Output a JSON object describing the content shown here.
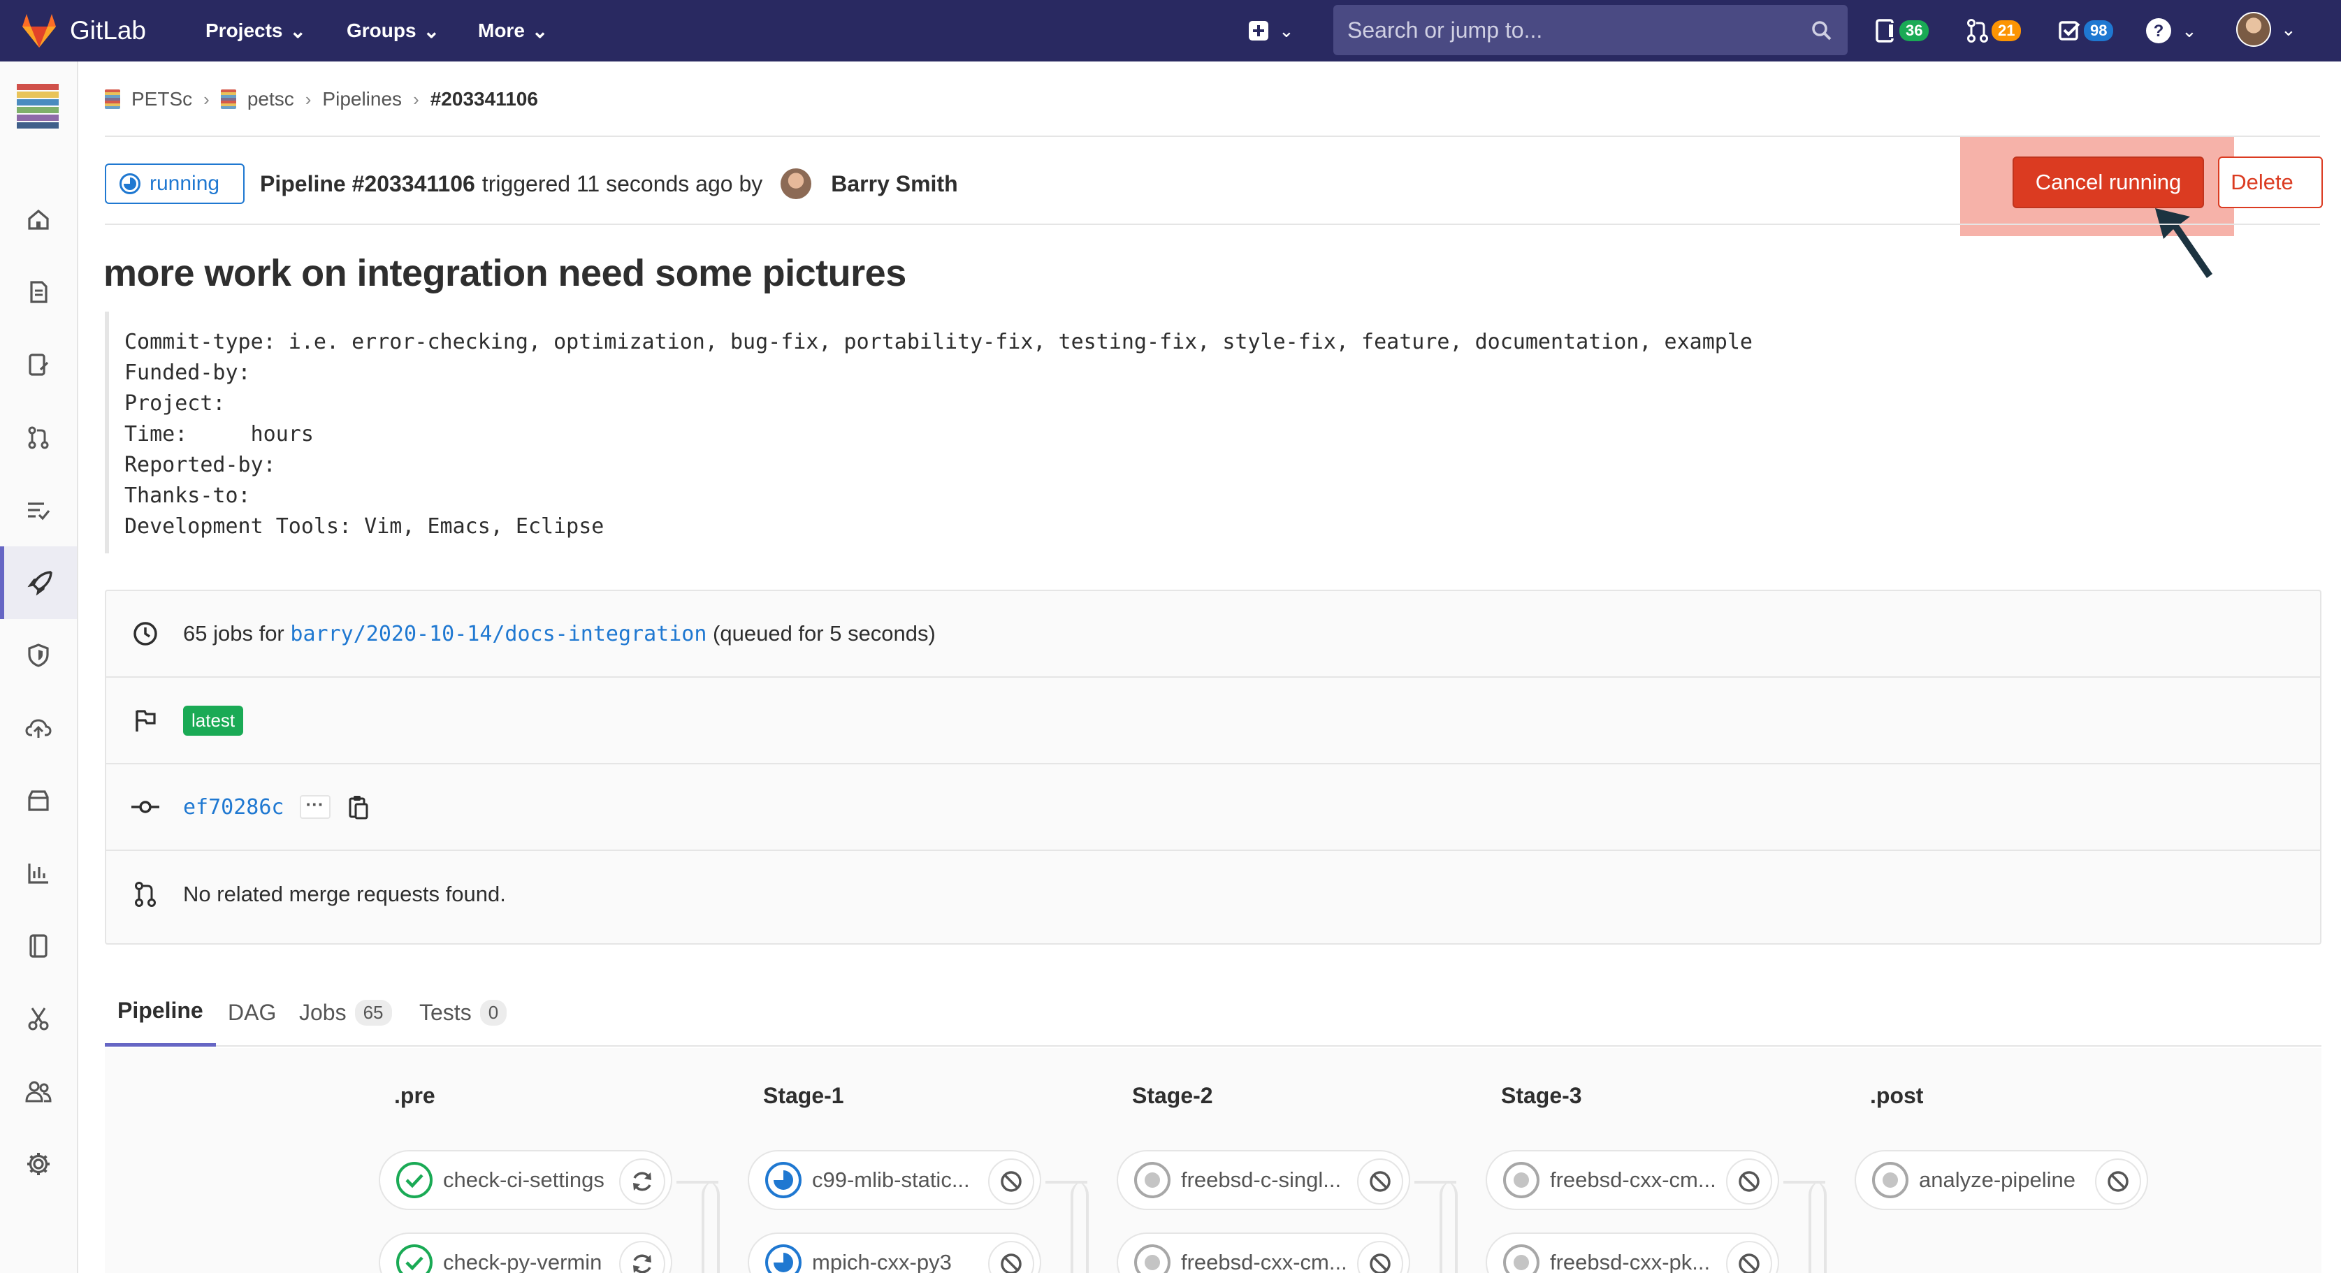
{
  "navbar": {
    "brand": "GitLab",
    "menus": [
      "Projects",
      "Groups",
      "More"
    ],
    "search_placeholder": "Search or jump to...",
    "issues_count": "36",
    "merge_requests_count": "21",
    "todos_count": "98",
    "colors": {
      "bar": "#292961",
      "issues_badge": "#1aaa55",
      "mr_badge": "#fc9403",
      "todos_badge": "#1f78d1"
    }
  },
  "breadcrumb": {
    "group": "PETSc",
    "project": "petsc",
    "section": "Pipelines",
    "current": "#203341106"
  },
  "pipeline_header": {
    "status": "running",
    "pipeline_label": "Pipeline #203341106",
    "triggered_text": "triggered 11 seconds ago by",
    "author": "Barry Smith",
    "cancel_label": "Cancel running",
    "delete_label": "Delete"
  },
  "commit": {
    "title": "more work on integration need some pictures",
    "description_lines": [
      "Commit-type: i.e. error-checking, optimization, bug-fix, portability-fix, testing-fix, style-fix, feature, documentation, example",
      "Funded-by:",
      "Project:",
      "Time:     hours",
      "Reported-by:",
      "Thanks-to:",
      "Development Tools: Vim, Emacs, Eclipse"
    ]
  },
  "info": {
    "jobs_prefix": "65 jobs for",
    "branch": "barry/2020-10-14/docs-integration",
    "queued_text": "(queued for 5 seconds)",
    "tag": "latest",
    "sha": "ef70286c",
    "merge_requests": "No related merge requests found."
  },
  "tabs": [
    {
      "label": "Pipeline",
      "count": null
    },
    {
      "label": "DAG",
      "count": null
    },
    {
      "label": "Jobs",
      "count": "65"
    },
    {
      "label": "Tests",
      "count": "0"
    }
  ],
  "stages": [
    {
      "name": ".pre",
      "jobs": [
        {
          "name": "check-ci-settings",
          "status": "success",
          "action": "retry"
        },
        {
          "name": "check-py-vermin",
          "status": "success",
          "action": "retry"
        }
      ]
    },
    {
      "name": "Stage-1",
      "jobs": [
        {
          "name": "c99-mlib-static...",
          "status": "running",
          "action": "cancel"
        },
        {
          "name": "mpich-cxx-py3",
          "status": "running",
          "action": "cancel"
        }
      ]
    },
    {
      "name": "Stage-2",
      "jobs": [
        {
          "name": "freebsd-c-singl...",
          "status": "created",
          "action": "cancel"
        },
        {
          "name": "freebsd-cxx-cm...",
          "status": "created",
          "action": "cancel"
        }
      ]
    },
    {
      "name": "Stage-3",
      "jobs": [
        {
          "name": "freebsd-cxx-cm...",
          "status": "created",
          "action": "cancel"
        },
        {
          "name": "freebsd-cxx-pk...",
          "status": "created",
          "action": "cancel"
        }
      ]
    },
    {
      "name": ".post",
      "jobs": [
        {
          "name": "analyze-pipeline",
          "status": "created",
          "action": "cancel"
        }
      ]
    }
  ],
  "icons": {
    "sidebar": [
      "home-icon",
      "repository-icon",
      "issues-icon",
      "merge-requests-icon",
      "requirements-icon",
      "cicd-icon",
      "security-icon",
      "deployments-icon",
      "packages-icon",
      "analytics-icon",
      "wiki-icon",
      "snippets-icon",
      "members-icon",
      "settings-icon"
    ]
  }
}
